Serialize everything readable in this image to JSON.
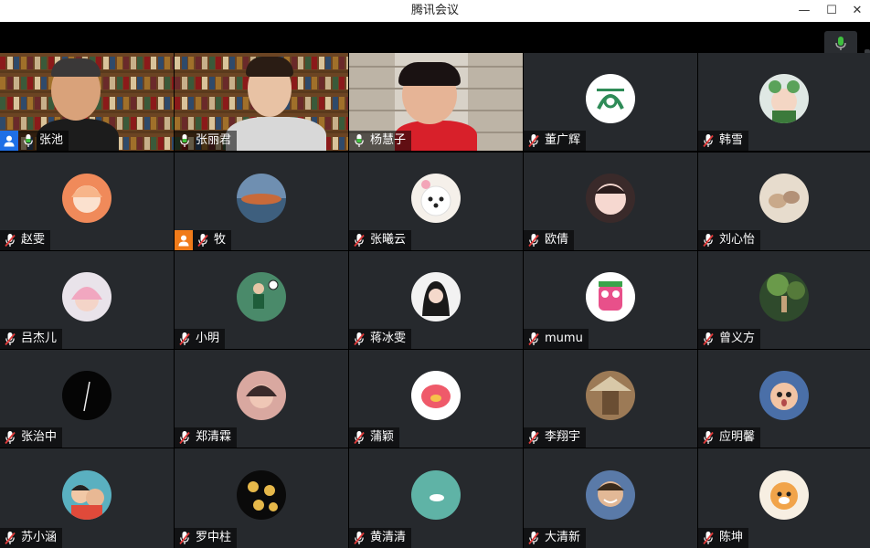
{
  "window": {
    "title": "腾讯会议",
    "minimize_glyph": "—",
    "maximize_glyph": "☐",
    "close_glyph": "✕"
  },
  "colors": {
    "tile_bg": "#26292d",
    "mic_on": "#3fbf3f",
    "mic_muted": "#e03a3a",
    "host_badge": "#1f6fe6",
    "cohost_badge": "#f07b1a"
  },
  "participants": [
    {
      "name": "张池",
      "mic": "on",
      "video": true,
      "badge": "host"
    },
    {
      "name": "张丽君",
      "mic": "on",
      "video": true
    },
    {
      "name": "杨慧子",
      "mic": "on",
      "video": true
    },
    {
      "name": "董广辉",
      "mic": "muted",
      "avatar": "green-logo"
    },
    {
      "name": "韩雪",
      "mic": "muted",
      "avatar": "frog-girl"
    },
    {
      "name": "赵雯",
      "mic": "muted",
      "avatar": "anime-girl"
    },
    {
      "name": "牧",
      "mic": "muted",
      "avatar": "sunset-sea",
      "badge": "cohost"
    },
    {
      "name": "张曦云",
      "mic": "muted",
      "avatar": "white-puppy"
    },
    {
      "name": "欧倩",
      "mic": "muted",
      "avatar": "cartoon-girl"
    },
    {
      "name": "刘心怡",
      "mic": "muted",
      "avatar": "cats"
    },
    {
      "name": "吕杰儿",
      "mic": "muted",
      "avatar": "pink-hair-girl"
    },
    {
      "name": "小明",
      "mic": "muted",
      "avatar": "soccer-player"
    },
    {
      "name": "蒋冰雯",
      "mic": "muted",
      "avatar": "dark-hair-girl"
    },
    {
      "name": "mumu",
      "mic": "muted",
      "avatar": "lion-dance"
    },
    {
      "name": "曾义方",
      "mic": "muted",
      "avatar": "forest-figure"
    },
    {
      "name": "张治中",
      "mic": "muted",
      "avatar": "black-circle"
    },
    {
      "name": "郑清霖",
      "mic": "muted",
      "avatar": "woman-portrait"
    },
    {
      "name": "蒲颖",
      "mic": "muted",
      "avatar": "pink-pig"
    },
    {
      "name": "李翔宇",
      "mic": "muted",
      "avatar": "straw-hat"
    },
    {
      "name": "应明馨",
      "mic": "muted",
      "avatar": "surprised-baby"
    },
    {
      "name": "苏小涵",
      "mic": "muted",
      "avatar": "cartoon-boys"
    },
    {
      "name": "罗中柱",
      "mic": "muted",
      "avatar": "gold-bears"
    },
    {
      "name": "黄清清",
      "mic": "muted",
      "avatar": "teal-water"
    },
    {
      "name": "大清新",
      "mic": "muted",
      "avatar": "smiling-man"
    },
    {
      "name": "陈坤",
      "mic": "muted",
      "avatar": "tiger-cartoon"
    }
  ]
}
